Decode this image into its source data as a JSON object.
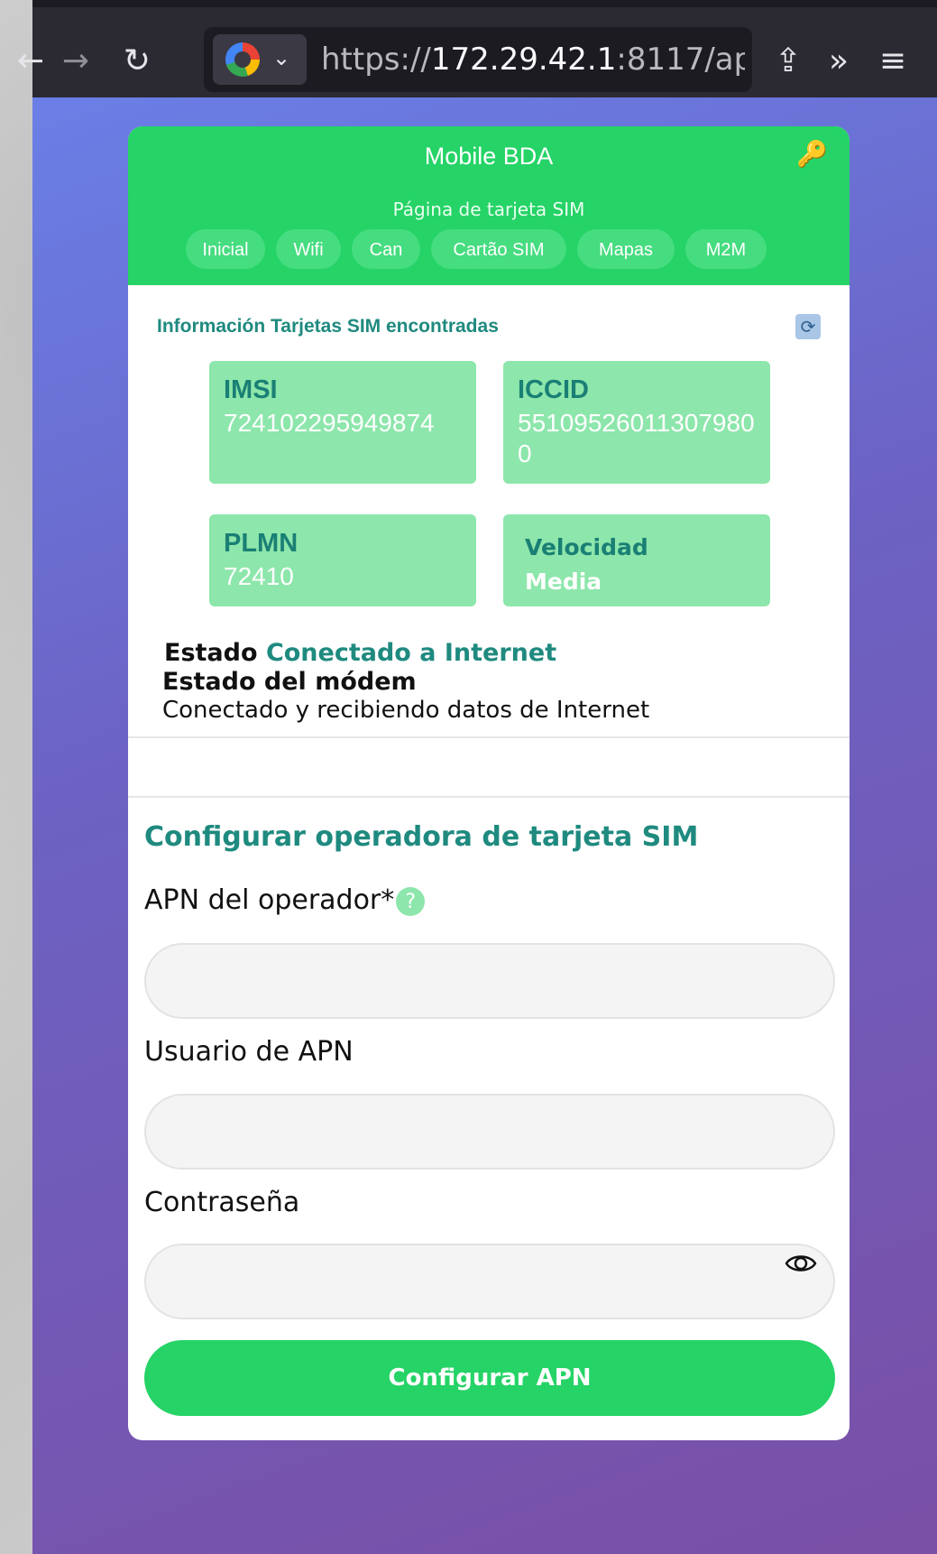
{
  "browser": {
    "url_scheme": "https://",
    "url_host": "172.29.42.1",
    "url_rest": ":8117/ap"
  },
  "app": {
    "title": "Mobile BDA",
    "subtitle": "Página de tarjeta SIM",
    "nav": [
      "Inicial",
      "Wifi",
      "Can",
      "Cartão SIM",
      "Mapas",
      "M2M"
    ]
  },
  "sim_info": {
    "title": "Información Tarjetas SIM encontradas",
    "tiles": [
      {
        "label": "IMSI",
        "value": "724102295949874"
      },
      {
        "label": "ICCID",
        "value": "551095260113079800"
      },
      {
        "label": "PLMN",
        "value": "72410"
      },
      {
        "label": "Velocidad",
        "value": "Media"
      }
    ],
    "estado_label": "Estado",
    "estado_value": "Conectado a Internet",
    "modem_label": "Estado del módem",
    "modem_value": "Conectado y recibiendo datos de Internet"
  },
  "config": {
    "title": "Configurar operadora de tarjeta SIM",
    "apn_label": "APN del operador*",
    "apn_help": "?",
    "user_label": "Usuario de APN",
    "password_label": "Contraseña",
    "submit_label": "Configurar APN"
  },
  "colors": {
    "accent": "#25d366",
    "tile": "#8de6ab",
    "teal_text": "#1f8a7f"
  },
  "icons": [
    "back-arrow-icon",
    "forward-arrow-icon",
    "reload-icon",
    "google-icon",
    "chevron-down-icon",
    "share-icon",
    "overflow-chevrons-icon",
    "menu-icon",
    "key-icon",
    "refresh-icon",
    "help-icon",
    "eye-icon"
  ]
}
